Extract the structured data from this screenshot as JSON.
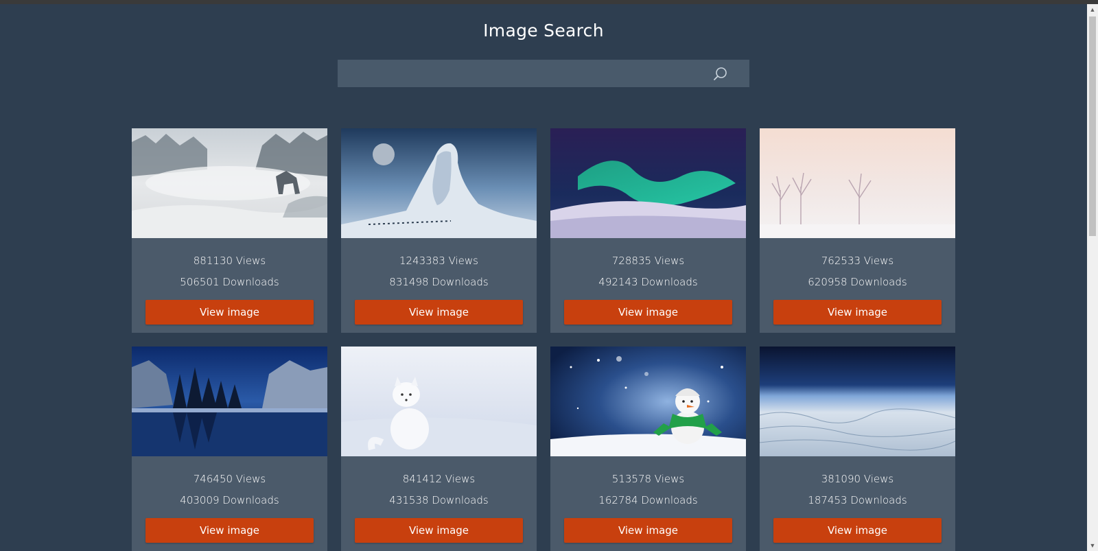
{
  "page": {
    "title": "Image Search"
  },
  "search": {
    "placeholder": "",
    "value": "",
    "icon": "search-icon"
  },
  "colors": {
    "background": "#2e3e50",
    "card": "#4b5a6a",
    "button": "#c8400e",
    "search": "#495a6b"
  },
  "cards": [
    {
      "scene": "wolf-fog",
      "views": "881130 Views",
      "downloads": "506501 Downloads",
      "button": "View image"
    },
    {
      "scene": "giant-moon",
      "views": "1243383 Views",
      "downloads": "831498 Downloads",
      "button": "View image"
    },
    {
      "scene": "aurora",
      "views": "728835 Views",
      "downloads": "492143 Downloads",
      "button": "View image"
    },
    {
      "scene": "misty-trees",
      "views": "762533 Views",
      "downloads": "620958 Downloads",
      "button": "View image"
    },
    {
      "scene": "yosemite-night",
      "views": "746450 Views",
      "downloads": "403009 Downloads",
      "button": "View image"
    },
    {
      "scene": "arctic-fox",
      "views": "841412 Views",
      "downloads": "431538 Downloads",
      "button": "View image"
    },
    {
      "scene": "snowman",
      "views": "513578 Views",
      "downloads": "162784 Downloads",
      "button": "View image"
    },
    {
      "scene": "earth-from-space",
      "views": "381090 Views",
      "downloads": "187453 Downloads",
      "button": "View image"
    }
  ]
}
